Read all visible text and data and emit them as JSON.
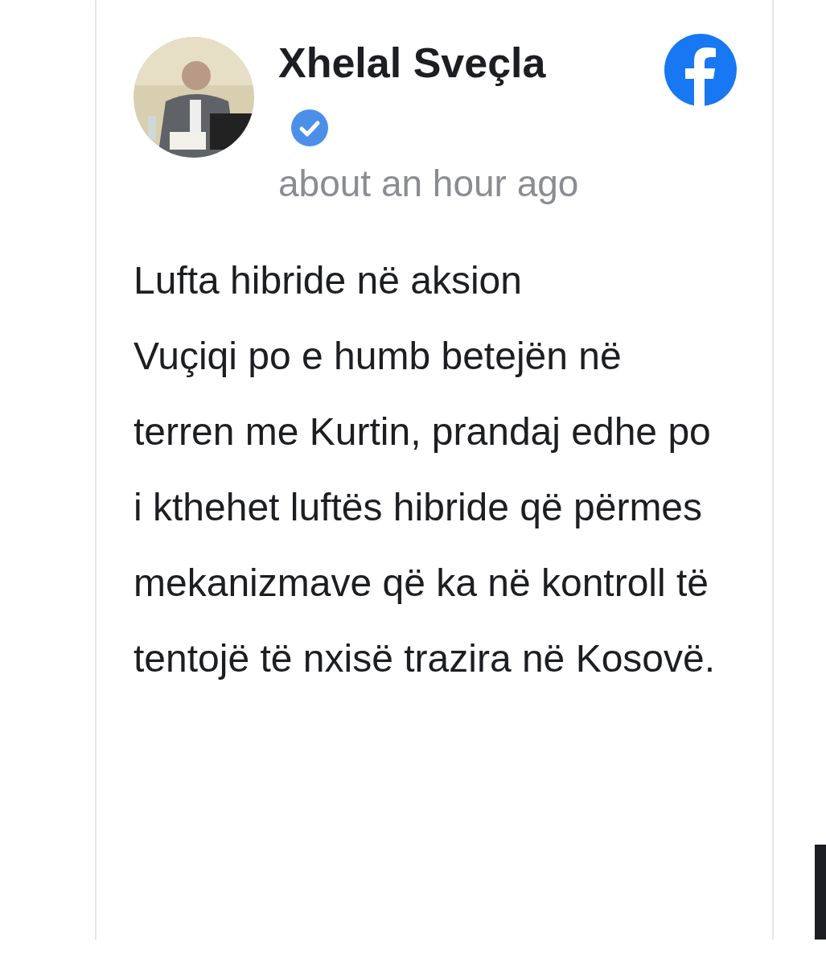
{
  "post": {
    "author": "Xhelal Sveçla",
    "verified": true,
    "time": "about an hour ago",
    "paragraphs": [
      "Lufta hibride në aksion",
      "Vuçiqi po e humb betejën në terren me Kurtin, prandaj edhe po i kthehet luftës hibride që përmes mekanizmave që ka në kontroll të tentojë të nxisë trazira në Kosovë."
    ]
  }
}
